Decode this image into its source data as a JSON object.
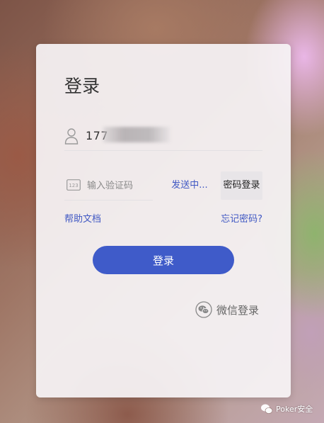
{
  "login_form": {
    "title": "登录",
    "phone_value": "177",
    "code_placeholder": "输入验证码",
    "send_code_status": "发送中...",
    "password_login_label": "密码登录",
    "help_link": "帮助文档",
    "forgot_password_link": "忘记密码?",
    "submit_label": "登录",
    "wechat_login_label": "微信登录"
  },
  "watermark": {
    "text": "Poker安全"
  },
  "icons": {
    "user": "user-icon",
    "code": "numeric-keypad-icon",
    "wechat": "wechat-icon"
  },
  "colors": {
    "accent": "#3f5bc9",
    "link": "#4058c3",
    "card_bg": "#f6f3f5"
  }
}
